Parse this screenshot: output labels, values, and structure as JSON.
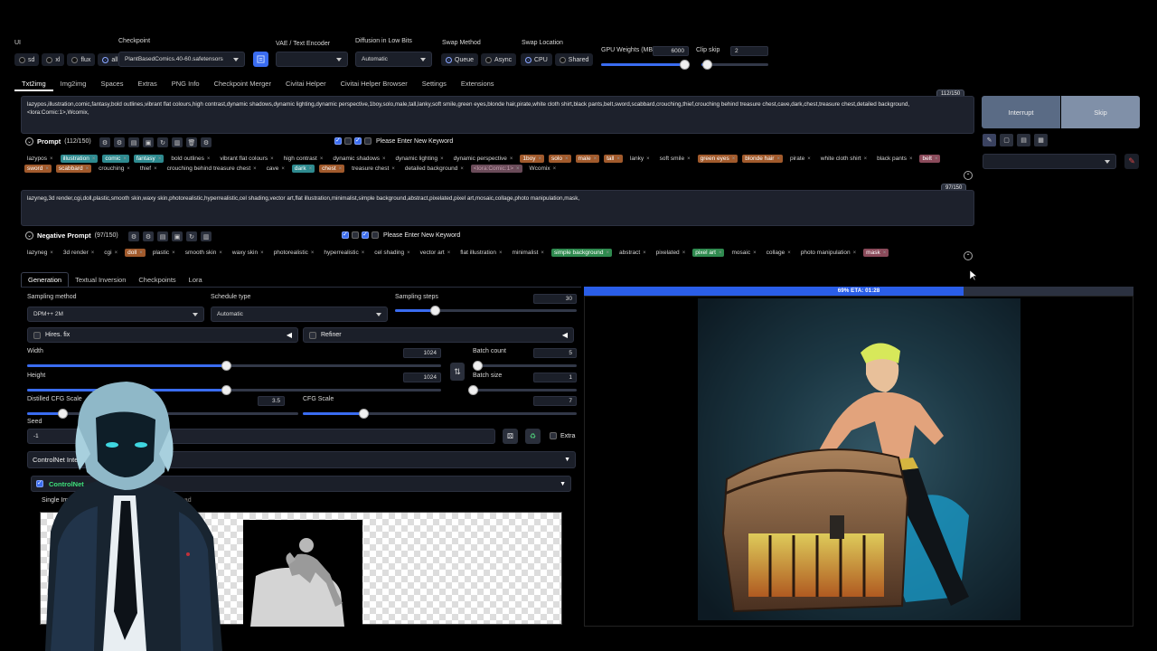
{
  "top": {
    "ui_label": "UI",
    "ui_options": [
      "sd",
      "xl",
      "flux",
      "all"
    ],
    "ui_selected": "all",
    "checkpoint_label": "Checkpoint",
    "checkpoint_value": "PlantBasedComics.40-60.safetensors",
    "vae_label": "VAE / Text Encoder",
    "vae_value": "",
    "diffusion_label": "Diffusion in Low Bits",
    "diffusion_value": "Automatic",
    "swap_method_label": "Swap Method",
    "swap_method_options": [
      "Queue",
      "Async"
    ],
    "swap_location_label": "Swap Location",
    "swap_location_options": [
      "CPU",
      "Shared"
    ],
    "gpu_weights_label": "GPU Weights (MB)",
    "gpu_weights_value": "6000",
    "gpu_weights_fraction": 0.95,
    "clip_skip_label": "Clip skip",
    "clip_skip_value": "2",
    "clip_skip_fraction": 0.08
  },
  "tabs": [
    "Txt2img",
    "Img2img",
    "Spaces",
    "Extras",
    "PNG Info",
    "Checkpoint Merger",
    "Civitai Helper",
    "Civitai Helper Browser",
    "Settings",
    "Extensions"
  ],
  "prompt": {
    "counter": "112/150",
    "text": "lazypos,illustration,comic,fantasy,bold outlines,vibrant flat colours,high contrast,dynamic shadows,dynamic lighting,dynamic perspective,1boy,solo,male,tall,lanky,soft smile,green eyes,blonde hair,pirate,white cloth shirt,black pants,belt,sword,scabbard,crouching,thief,crouching behind treasure chest,cave,dark,chest,treasure chest,detailed background,<lora:Comic:1>,Wcomix,",
    "header_label": "Prompt",
    "header_count": "(112/150)",
    "keyword_placeholder": "Please Enter New Keyword",
    "tags": [
      {
        "t": "lazypos",
        "c": ""
      },
      {
        "t": "illustration",
        "c": "teal"
      },
      {
        "t": "comic",
        "c": "teal"
      },
      {
        "t": "fantasy",
        "c": "teal"
      },
      {
        "t": "bold outlines",
        "c": ""
      },
      {
        "t": "vibrant flat colours",
        "c": ""
      },
      {
        "t": "high contrast",
        "c": ""
      },
      {
        "t": "dynamic shadows",
        "c": ""
      },
      {
        "t": "dynamic lighting",
        "c": ""
      },
      {
        "t": "dynamic perspective",
        "c": ""
      },
      {
        "t": "1boy",
        "c": "orange"
      },
      {
        "t": "solo",
        "c": "orange"
      },
      {
        "t": "male",
        "c": "orange"
      },
      {
        "t": "tall",
        "c": "orange"
      },
      {
        "t": "lanky",
        "c": ""
      },
      {
        "t": "soft smile",
        "c": ""
      },
      {
        "t": "green eyes",
        "c": "orange"
      },
      {
        "t": "blonde hair",
        "c": "orange"
      },
      {
        "t": "pirate",
        "c": ""
      },
      {
        "t": "white cloth shirt",
        "c": ""
      },
      {
        "t": "black pants",
        "c": ""
      },
      {
        "t": "belt",
        "c": "pink"
      },
      {
        "t": "sword",
        "c": "orange"
      },
      {
        "t": "scabbard",
        "c": "orange"
      },
      {
        "t": "crouching",
        "c": ""
      },
      {
        "t": "thief",
        "c": ""
      },
      {
        "t": "crouching behind treasure chest",
        "c": ""
      },
      {
        "t": "cave",
        "c": ""
      },
      {
        "t": "dark",
        "c": "teal"
      },
      {
        "t": "chest",
        "c": "orange"
      },
      {
        "t": "treasure chest",
        "c": ""
      },
      {
        "t": "detailed background",
        "c": ""
      },
      {
        "t": "<lora:Comic:1>",
        "c": "ghost"
      },
      {
        "t": "Wcomix",
        "c": ""
      }
    ]
  },
  "negative": {
    "counter": "97/150",
    "text": "lazyneg,3d render,cgi,doll,plastic,smooth skin,waxy skin,photorealistic,hyperrealistic,cel shading,vector art,flat illustration,minimalist,simple background,abstract,pixelated,pixel art,mosaic,collage,photo manipulation,mask,",
    "header_label": "Negative Prompt",
    "header_count": "(97/150)",
    "keyword_placeholder": "Please Enter New Keyword",
    "tags": [
      {
        "t": "lazyneg",
        "c": ""
      },
      {
        "t": "3d render",
        "c": ""
      },
      {
        "t": "cgi",
        "c": ""
      },
      {
        "t": "doll",
        "c": "orange"
      },
      {
        "t": "plastic",
        "c": ""
      },
      {
        "t": "smooth skin",
        "c": ""
      },
      {
        "t": "waxy skin",
        "c": ""
      },
      {
        "t": "photorealistic",
        "c": ""
      },
      {
        "t": "hyperrealistic",
        "c": ""
      },
      {
        "t": "cel shading",
        "c": ""
      },
      {
        "t": "vector art",
        "c": ""
      },
      {
        "t": "flat illustration",
        "c": ""
      },
      {
        "t": "minimalist",
        "c": ""
      },
      {
        "t": "simple background",
        "c": "green"
      },
      {
        "t": "abstract",
        "c": ""
      },
      {
        "t": "pixelated",
        "c": ""
      },
      {
        "t": "pixel art",
        "c": "green"
      },
      {
        "t": "mosaic",
        "c": ""
      },
      {
        "t": "collage",
        "c": ""
      },
      {
        "t": "photo manipulation",
        "c": ""
      },
      {
        "t": "mask",
        "c": "pink"
      }
    ]
  },
  "right_panel": {
    "interrupt": "Interrupt",
    "skip": "Skip"
  },
  "gen_tabs": [
    "Generation",
    "Textual Inversion",
    "Checkpoints",
    "Lora"
  ],
  "generation": {
    "sampling_method_label": "Sampling method",
    "sampling_method_value": "DPM++ 2M",
    "schedule_type_label": "Schedule type",
    "schedule_type_value": "Automatic",
    "sampling_steps_label": "Sampling steps",
    "sampling_steps_value": "30",
    "sampling_steps_fraction": 0.22,
    "hires_label": "Hires. fix",
    "refiner_label": "Refiner",
    "width_label": "Width",
    "width_value": "1024",
    "width_fraction": 0.48,
    "height_label": "Height",
    "height_value": "1024",
    "height_fraction": 0.48,
    "batch_count_label": "Batch count",
    "batch_count_value": "5",
    "batch_count_fraction": 0.04,
    "batch_size_label": "Batch size",
    "batch_size_value": "1",
    "batch_size_fraction": 0.0,
    "distilled_cfg_label": "Distilled CFG Scale",
    "distilled_cfg_value": "3.5",
    "distilled_cfg_fraction": 0.13,
    "cfg_label": "CFG Scale",
    "cfg_value": "7",
    "cfg_fraction": 0.22,
    "seed_label": "Seed",
    "seed_value": "-1",
    "extra_label": "Extra",
    "controlnet_label": "ControlNet Integr",
    "controlnet_unit_label": "ControlNet",
    "single_image_label": "Single Ima",
    "upload_label": "oad"
  },
  "progress": {
    "text": "69% ETA: 01:28",
    "fraction": 0.69
  },
  "colors": {
    "accent": "#3a6cf0",
    "panel": "#1b1f29",
    "controlnet_green": "#3ee07a"
  }
}
